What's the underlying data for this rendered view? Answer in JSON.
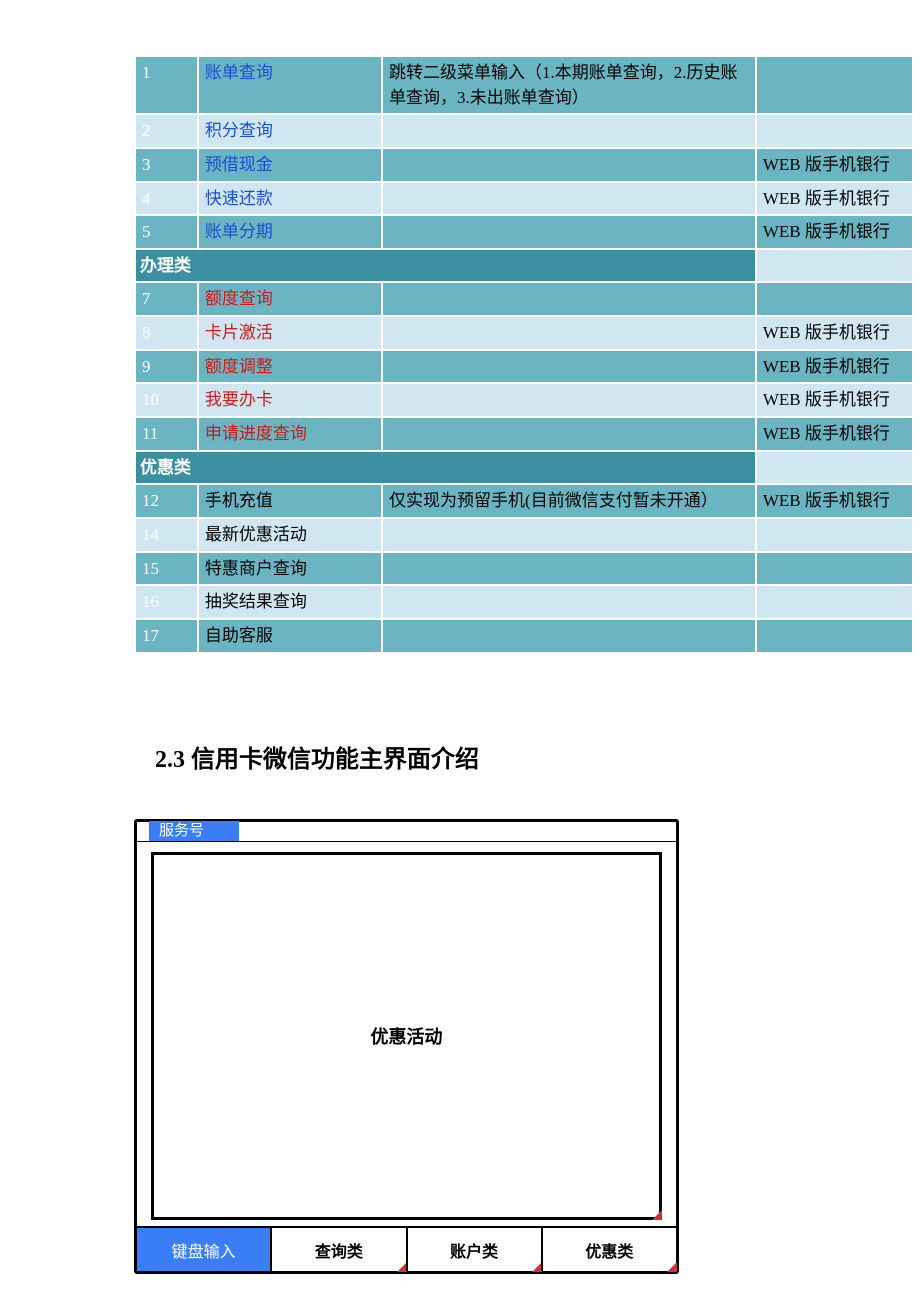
{
  "table": {
    "rows": [
      {
        "type": "row",
        "shade": "dark",
        "idx": "1",
        "name": "账单查询",
        "nameClass": "blue",
        "desc": "跳转二级菜单输入（1.本期账单查询，2.历史账单查询，3.未出账单查询）",
        "channel": ""
      },
      {
        "type": "row",
        "shade": "light",
        "idx": "2",
        "name": "积分查询",
        "nameClass": "blue",
        "desc": "",
        "channel": ""
      },
      {
        "type": "row",
        "shade": "dark",
        "idx": "3",
        "name": "预借现金",
        "nameClass": "blue",
        "desc": "",
        "channel": "WEB 版手机银行"
      },
      {
        "type": "row",
        "shade": "light",
        "idx": "4",
        "name": "快速还款",
        "nameClass": "blue",
        "desc": "",
        "channel": "WEB 版手机银行"
      },
      {
        "type": "row",
        "shade": "dark",
        "idx": "5",
        "name": "账单分期",
        "nameClass": "blue",
        "desc": "",
        "channel": "WEB 版手机银行"
      },
      {
        "type": "section",
        "label": "办理类"
      },
      {
        "type": "row",
        "shade": "dark",
        "idx": "7",
        "name": "额度查询",
        "nameClass": "red",
        "desc": "",
        "channel": ""
      },
      {
        "type": "row",
        "shade": "light",
        "idx": "8",
        "name": "卡片激活",
        "nameClass": "red",
        "desc": "",
        "channel": "WEB 版手机银行"
      },
      {
        "type": "row",
        "shade": "dark",
        "idx": "9",
        "name": "额度调整",
        "nameClass": "red",
        "desc": "",
        "channel": "WEB 版手机银行"
      },
      {
        "type": "row",
        "shade": "light",
        "idx": "10",
        "name": "我要办卡",
        "nameClass": "red",
        "desc": "",
        "channel": "WEB 版手机银行"
      },
      {
        "type": "row",
        "shade": "dark",
        "idx": "11",
        "name": "申请进度查询",
        "nameClass": "red",
        "desc": "",
        "channel": "WEB 版手机银行"
      },
      {
        "type": "section",
        "label": "优惠类"
      },
      {
        "type": "row",
        "shade": "dark",
        "idx": "12",
        "name": "手机充值",
        "nameClass": "",
        "desc": "仅实现为预留手机(目前微信支付暂未开通）",
        "channel": "WEB 版手机银行"
      },
      {
        "type": "row",
        "shade": "light",
        "idx": "14",
        "name": "最新优惠活动",
        "nameClass": "",
        "desc": "",
        "channel": ""
      },
      {
        "type": "row",
        "shade": "dark",
        "idx": "15",
        "name": "特惠商户查询",
        "nameClass": "",
        "desc": "",
        "channel": ""
      },
      {
        "type": "row",
        "shade": "light",
        "idx": "16",
        "name": "抽奖结果查询",
        "nameClass": "",
        "desc": "",
        "channel": ""
      },
      {
        "type": "row",
        "shade": "dark",
        "idx": "17",
        "name": "自助客服",
        "nameClass": "",
        "desc": "",
        "channel": ""
      }
    ]
  },
  "heading": "2.3 信用卡微信功能主界面介绍",
  "mockup": {
    "headerTab": "服务号",
    "content": "优惠活动",
    "bottom": [
      "键盘输入",
      "查询类",
      "账户类",
      "优惠类"
    ]
  }
}
